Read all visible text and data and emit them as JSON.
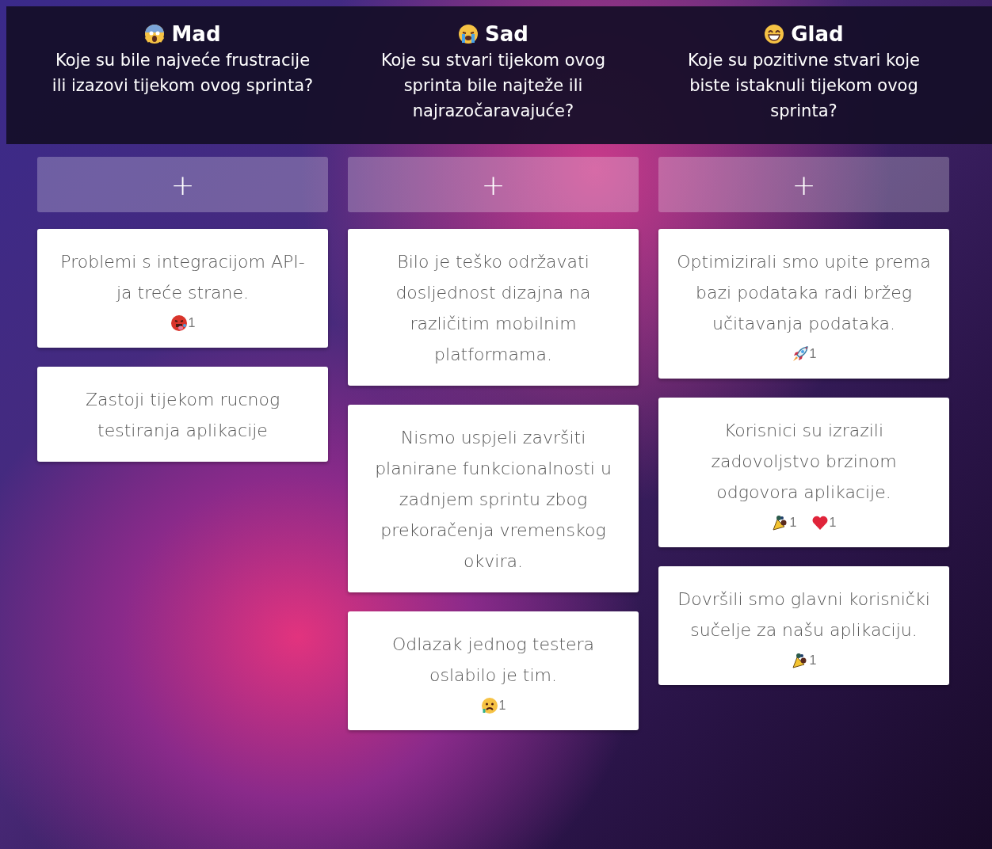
{
  "columns": [
    {
      "kind": "scream",
      "title": "Mad",
      "question": "Koje su bile najveće frustracije ili izazovi tijekom ovog sprinta?",
      "add": "+",
      "cards": [
        {
          "text": "Problemi s integracijom API-ja treće strane.",
          "reactions": [
            {
              "kind": "sick-face",
              "count": "1"
            }
          ]
        },
        {
          "text": "Zastoji tijekom rucnog testiranja aplikacije"
        }
      ]
    },
    {
      "kind": "crying",
      "title": "Sad",
      "question": "Koje su stvari tijekom ovog sprinta bile najteže ili najrazočaravajuće?",
      "add": "+",
      "cards": [
        {
          "text": "Bilo je teško održavati dosljednost dizajna na različitim mobilnim platformama."
        },
        {
          "text": "Nismo uspjeli završiti planirane funkcionalnosti u zadnjem sprintu zbog prekoračenja vremenskog okvira."
        },
        {
          "text": "Odlazak jednog testera oslabilo je tim.",
          "reactions": [
            {
              "kind": "sad-face",
              "count": "1"
            }
          ]
        }
      ]
    },
    {
      "kind": "grin",
      "title": "Glad",
      "question": "Koje su pozitivne stvari koje biste istaknuli tijekom ovog sprinta?",
      "add": "+",
      "cards": [
        {
          "text": "Optimizirali smo upite prema bazi podataka radi bržeg učitavanja podataka.",
          "reactions": [
            {
              "kind": "rocket",
              "count": "1"
            }
          ]
        },
        {
          "text": "Korisnici su izrazili zadovoljstvo brzinom odgovora aplikacije.",
          "reactions": [
            {
              "kind": "party-popper",
              "count": "1"
            },
            {
              "kind": "heart",
              "count": "1"
            }
          ]
        },
        {
          "text": "Dovršili smo glavni korisnički sučelje za našu aplikaciju.",
          "reactions": [
            {
              "kind": "party-popper",
              "count": "1"
            }
          ]
        }
      ]
    }
  ]
}
